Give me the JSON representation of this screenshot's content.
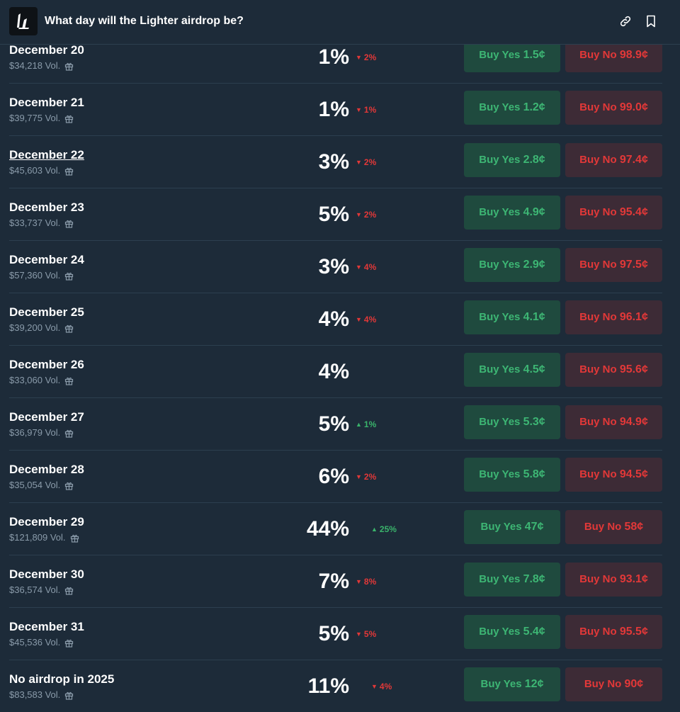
{
  "header": {
    "title": "What day will the Lighter airdrop be?",
    "logo_icon": "lighter-logo",
    "link_icon": "link-icon",
    "bookmark_icon": "bookmark-icon"
  },
  "colors": {
    "background": "#1d2b39",
    "yes_bg": "#1f4a3e",
    "yes_text": "#3db674",
    "no_bg": "#3d2b36",
    "no_text": "#e23838",
    "down": "#e23838",
    "up": "#3ab36b"
  },
  "rows": [
    {
      "label": "December 20",
      "volume": "$34,218 Vol.",
      "pct": "1%",
      "change": "2%",
      "dir": "down",
      "yes_label": "Buy Yes",
      "yes_price": "1.5¢",
      "no_label": "Buy No",
      "no_price": "98.9¢"
    },
    {
      "label": "December 21",
      "volume": "$39,775 Vol.",
      "pct": "1%",
      "change": "1%",
      "dir": "down",
      "yes_label": "Buy Yes",
      "yes_price": "1.2¢",
      "no_label": "Buy No",
      "no_price": "99.0¢"
    },
    {
      "label": "December 22",
      "volume": "$45,603 Vol.",
      "pct": "3%",
      "change": "2%",
      "dir": "down",
      "yes_label": "Buy Yes",
      "yes_price": "2.8¢",
      "no_label": "Buy No",
      "no_price": "97.4¢"
    },
    {
      "label": "December 23",
      "volume": "$33,737 Vol.",
      "pct": "5%",
      "change": "2%",
      "dir": "down",
      "yes_label": "Buy Yes",
      "yes_price": "4.9¢",
      "no_label": "Buy No",
      "no_price": "95.4¢"
    },
    {
      "label": "December 24",
      "volume": "$57,360 Vol.",
      "pct": "3%",
      "change": "4%",
      "dir": "down",
      "yes_label": "Buy Yes",
      "yes_price": "2.9¢",
      "no_label": "Buy No",
      "no_price": "97.5¢"
    },
    {
      "label": "December 25",
      "volume": "$39,200 Vol.",
      "pct": "4%",
      "change": "4%",
      "dir": "down",
      "yes_label": "Buy Yes",
      "yes_price": "4.1¢",
      "no_label": "Buy No",
      "no_price": "96.1¢"
    },
    {
      "label": "December 26",
      "volume": "$33,060 Vol.",
      "pct": "4%",
      "change": "",
      "dir": "none",
      "yes_label": "Buy Yes",
      "yes_price": "4.5¢",
      "no_label": "Buy No",
      "no_price": "95.6¢"
    },
    {
      "label": "December 27",
      "volume": "$36,979 Vol.",
      "pct": "5%",
      "change": "1%",
      "dir": "up",
      "yes_label": "Buy Yes",
      "yes_price": "5.3¢",
      "no_label": "Buy No",
      "no_price": "94.9¢"
    },
    {
      "label": "December 28",
      "volume": "$35,054 Vol.",
      "pct": "6%",
      "change": "2%",
      "dir": "down",
      "yes_label": "Buy Yes",
      "yes_price": "5.8¢",
      "no_label": "Buy No",
      "no_price": "94.5¢"
    },
    {
      "label": "December 29",
      "volume": "$121,809 Vol.",
      "pct": "44%",
      "change": "25%",
      "dir": "up",
      "yes_label": "Buy Yes",
      "yes_price": "47¢",
      "no_label": "Buy No",
      "no_price": "58¢"
    },
    {
      "label": "December 30",
      "volume": "$36,574 Vol.",
      "pct": "7%",
      "change": "8%",
      "dir": "down",
      "yes_label": "Buy Yes",
      "yes_price": "7.8¢",
      "no_label": "Buy No",
      "no_price": "93.1¢"
    },
    {
      "label": "December 31",
      "volume": "$45,536 Vol.",
      "pct": "5%",
      "change": "5%",
      "dir": "down",
      "yes_label": "Buy Yes",
      "yes_price": "5.4¢",
      "no_label": "Buy No",
      "no_price": "95.5¢"
    },
    {
      "label": "No airdrop in 2025",
      "volume": "$83,583 Vol.",
      "pct": "11%",
      "change": "4%",
      "dir": "down",
      "yes_label": "Buy Yes",
      "yes_price": "12¢",
      "no_label": "Buy No",
      "no_price": "90¢"
    }
  ]
}
